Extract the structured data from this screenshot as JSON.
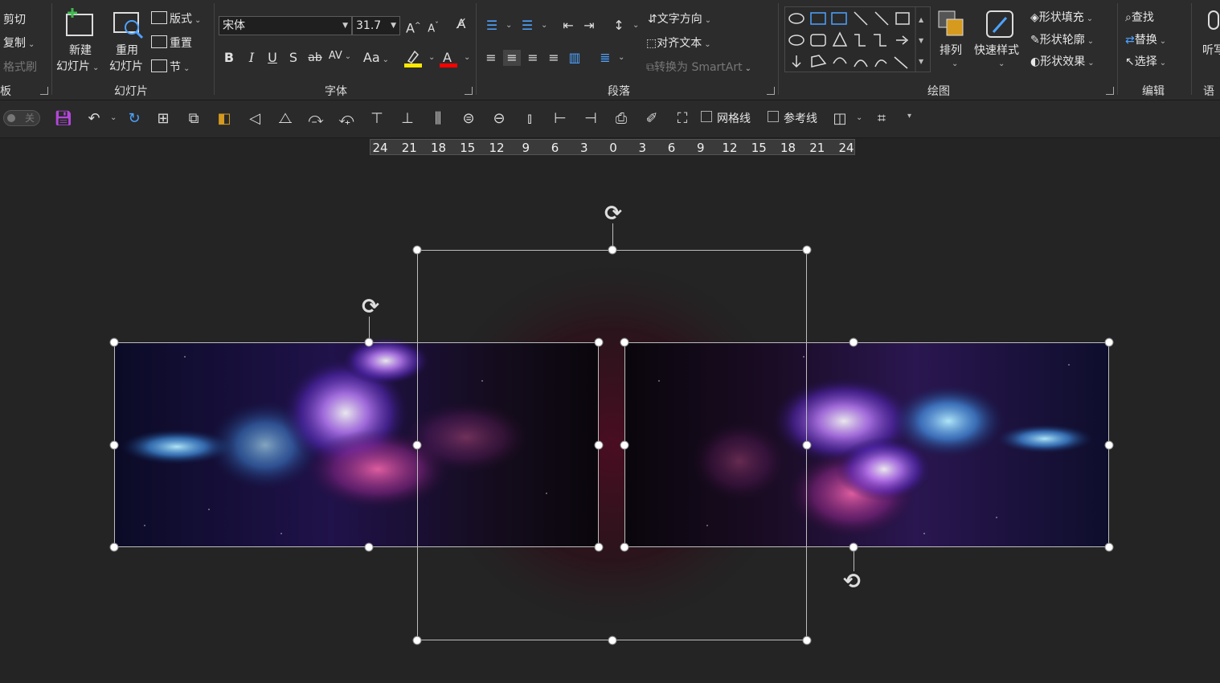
{
  "clipboard": {
    "cut": "剪切",
    "copy": "复制",
    "format_painter": "格式刷",
    "partial_label": "板"
  },
  "slides": {
    "new_line1": "新建",
    "new_line2": "幻灯片",
    "reuse_line1": "重用",
    "reuse_line2": "幻灯片",
    "layout": "版式",
    "reset": "重置",
    "section": "节",
    "group_label": "幻灯片"
  },
  "font": {
    "font_name": "宋体",
    "font_size": "31.7",
    "bold": "B",
    "italic": "I",
    "underline": "U",
    "shadow": "S",
    "strike": "ab",
    "spacing": "AV",
    "case": "Aa",
    "grow": "A",
    "shrink": "A",
    "group_label": "字体",
    "highlight_color": "#ffe800",
    "font_color": "#ff0000"
  },
  "paragraph": {
    "text_direction": "文字方向",
    "align_text": "对齐文本",
    "smartart": "转换为 SmartArt",
    "group_label": "段落"
  },
  "drawing": {
    "arrange": "排列",
    "quick_styles": "快速样式",
    "shape_fill": "形状填充",
    "shape_outline": "形状轮廓",
    "shape_effects": "形状效果",
    "group_label": "绘图"
  },
  "editing": {
    "find": "查找",
    "replace": "替换",
    "select": "选择",
    "group_label": "编辑"
  },
  "voice": {
    "dictate": "听写",
    "group_label": "语音"
  },
  "toolbar": {
    "toggle_off": "关",
    "gridlines": "网格线",
    "guides": "参考线"
  },
  "ruler": {
    "ticks": [
      "24",
      "21",
      "18",
      "15",
      "12",
      "9",
      "6",
      "3",
      "0",
      "3",
      "6",
      "9",
      "12",
      "15",
      "18",
      "21",
      "24"
    ]
  },
  "colors": {
    "ribbon_bg": "#2c2c2c",
    "canvas_bg": "#242424",
    "accent_purple": "#b347d9"
  }
}
